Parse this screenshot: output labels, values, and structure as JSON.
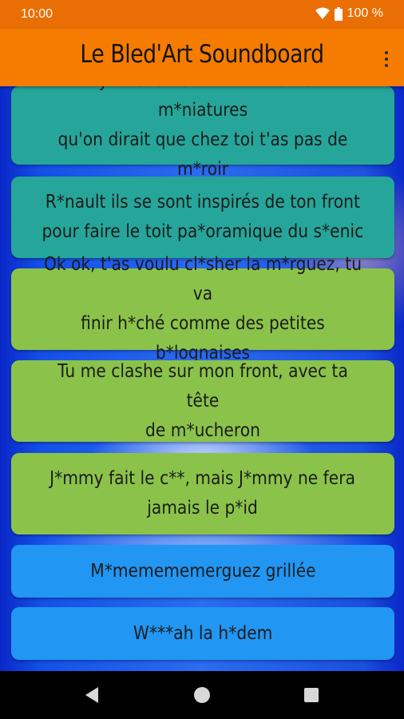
{
  "status": {
    "time": "10:00",
    "battery": "100 %"
  },
  "app": {
    "title": "Le Bled'Art Soundboard"
  },
  "sounds": [
    {
      "line1": "Il y a tellement ta t*te sur les m*niatures",
      "line2": "qu'on dirait que chez toi t'as pas de m*roir",
      "color": "#26a69a"
    },
    {
      "line1": "R*nault ils se sont inspirés de ton front",
      "line2": "pour faire le toit pa*oramique du s*enic",
      "color": "#26a69a"
    },
    {
      "line1": "Ok ok, t'as voulu cl*sher la m*rguez, tu va",
      "line2": "finir h*ché comme des petites b*lognaises",
      "color": "#8bc34a"
    },
    {
      "line1": "Tu me clashe sur mon front, avec ta tête",
      "line2": "de m*ucheron",
      "color": "#8bc34a"
    },
    {
      "line1": "J*mmy fait le c**, mais J*mmy ne fera",
      "line2": "jamais le p*id",
      "color": "#8bc34a"
    },
    {
      "line1": "M*memememerguez grillée",
      "color": "#2196f3"
    },
    {
      "line1": "W***ah la h*dem",
      "color": "#2196f3"
    }
  ]
}
